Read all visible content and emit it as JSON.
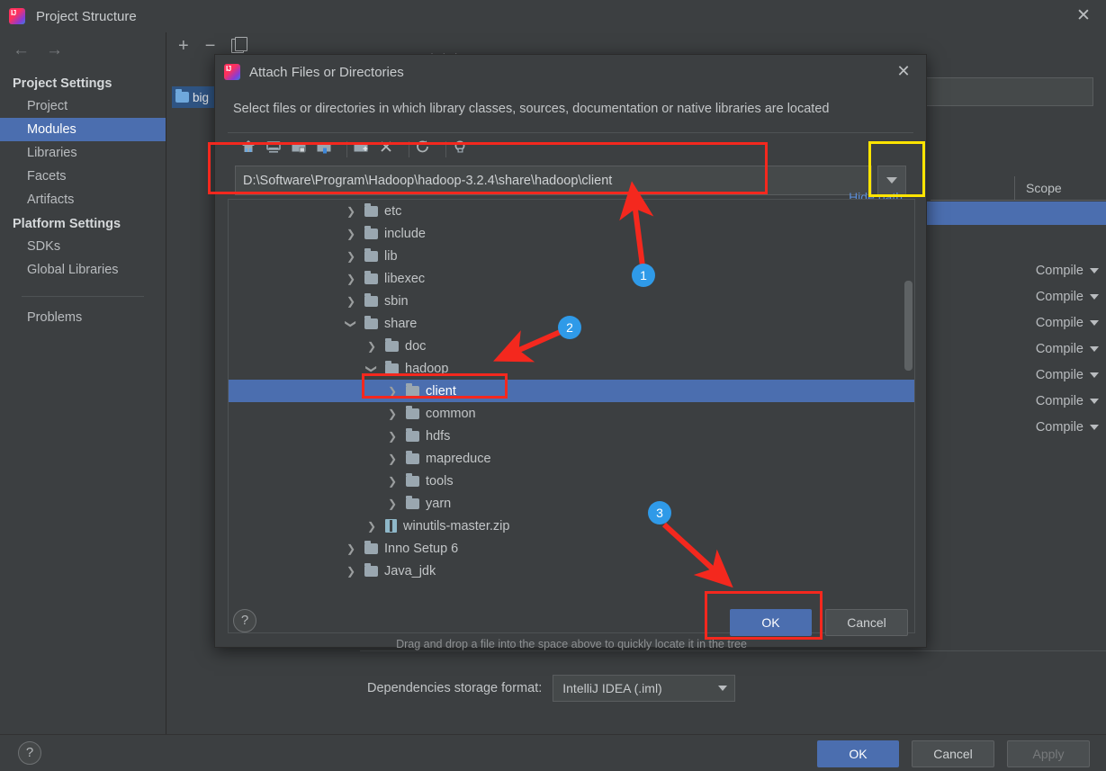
{
  "window": {
    "title": "Project Structure",
    "app_icon": "intellij-idea-icon",
    "close_icon": "close-icon",
    "nav_back_icon": "arrow-left-icon",
    "nav_forward_icon": "arrow-right-icon"
  },
  "sidebar": {
    "groups": [
      {
        "label": "Project Settings",
        "items": [
          {
            "label": "Project",
            "selected": false
          },
          {
            "label": "Modules",
            "selected": true
          },
          {
            "label": "Libraries",
            "selected": false
          },
          {
            "label": "Facets",
            "selected": false
          },
          {
            "label": "Artifacts",
            "selected": false
          }
        ]
      },
      {
        "label": "Platform Settings",
        "items": [
          {
            "label": "SDKs",
            "selected": false
          },
          {
            "label": "Global Libraries",
            "selected": false
          }
        ]
      }
    ],
    "problems_label": "Problems"
  },
  "main_toolbar": {
    "add_label": "+",
    "remove_label": "−",
    "copy_icon": "copy-icon"
  },
  "module_chip": {
    "label": "big"
  },
  "dependencies_table": {
    "columns": [
      "",
      "Scope"
    ],
    "scope_values": [
      "Compile",
      "Compile",
      "Compile",
      "Compile",
      "Compile",
      "Compile",
      "Compile"
    ]
  },
  "dependencies_storage": {
    "label": "Dependencies storage format:",
    "value": "IntelliJ IDEA (.iml)"
  },
  "main_buttons": {
    "help_label": "?",
    "ok": "OK",
    "cancel": "Cancel",
    "apply": "Apply"
  },
  "dialog": {
    "title": "Attach Files or Directories",
    "icon": "intellij-idea-icon",
    "close_icon": "close-icon",
    "subtitle": "Select files or directories in which library classes, sources, documentation or native libraries are located",
    "toolbar_icons": [
      "home-icon",
      "desktop-icon",
      "project-folder-icon",
      "module-folder-icon",
      "new-folder-icon",
      "delete-icon",
      "refresh-icon",
      "show-hidden-icon"
    ],
    "hide_path_label": "Hide path",
    "path_value": "D:\\Software\\Program\\Hadoop\\hadoop-3.2.4\\share\\hadoop\\client",
    "path_dropdown_icon": "chevron-down-icon",
    "tree": [
      {
        "name": "etc",
        "indent": 1,
        "state": "collapsed",
        "icon": "folder-icon",
        "selected": false
      },
      {
        "name": "include",
        "indent": 1,
        "state": "collapsed",
        "icon": "folder-icon",
        "selected": false
      },
      {
        "name": "lib",
        "indent": 1,
        "state": "collapsed",
        "icon": "folder-icon",
        "selected": false
      },
      {
        "name": "libexec",
        "indent": 1,
        "state": "collapsed",
        "icon": "folder-icon",
        "selected": false
      },
      {
        "name": "sbin",
        "indent": 1,
        "state": "collapsed",
        "icon": "folder-icon",
        "selected": false
      },
      {
        "name": "share",
        "indent": 1,
        "state": "expanded",
        "icon": "folder-icon",
        "selected": false
      },
      {
        "name": "doc",
        "indent": 2,
        "state": "collapsed",
        "icon": "folder-icon",
        "selected": false
      },
      {
        "name": "hadoop",
        "indent": 2,
        "state": "expanded",
        "icon": "folder-icon",
        "selected": false
      },
      {
        "name": "client",
        "indent": 3,
        "state": "collapsed",
        "icon": "folder-icon",
        "selected": true
      },
      {
        "name": "common",
        "indent": 3,
        "state": "collapsed",
        "icon": "folder-icon",
        "selected": false
      },
      {
        "name": "hdfs",
        "indent": 3,
        "state": "collapsed",
        "icon": "folder-icon",
        "selected": false
      },
      {
        "name": "mapreduce",
        "indent": 3,
        "state": "collapsed",
        "icon": "folder-icon",
        "selected": false
      },
      {
        "name": "tools",
        "indent": 3,
        "state": "collapsed",
        "icon": "folder-icon",
        "selected": false
      },
      {
        "name": "yarn",
        "indent": 3,
        "state": "collapsed",
        "icon": "folder-icon",
        "selected": false
      },
      {
        "name": "winutils-master.zip",
        "indent": 2,
        "state": "collapsed",
        "icon": "archive-icon",
        "selected": false
      },
      {
        "name": "Inno Setup 6",
        "indent": 1,
        "state": "collapsed",
        "icon": "folder-icon",
        "selected": false
      },
      {
        "name": "Java_jdk",
        "indent": 1,
        "state": "collapsed",
        "icon": "folder-icon",
        "selected": false
      }
    ],
    "hint": "Drag and drop a file into the space above to quickly locate it in the tree",
    "help_label": "?",
    "ok": "OK",
    "cancel": "Cancel"
  },
  "annotations": {
    "markers": [
      {
        "number": "1"
      },
      {
        "number": "2"
      },
      {
        "number": "3"
      }
    ],
    "highlight_color": "#f4281e",
    "secondary_color": "#ffe400",
    "marker_color": "#2f9ae8"
  }
}
